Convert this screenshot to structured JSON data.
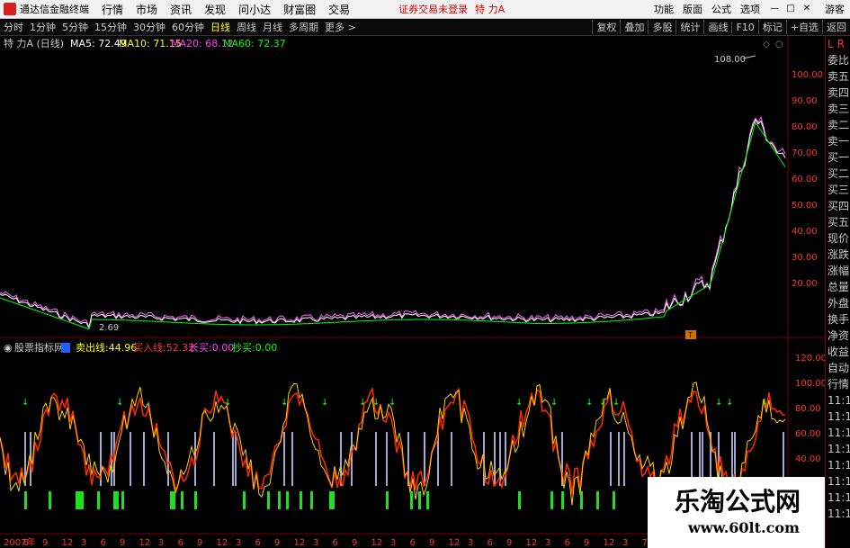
{
  "menubar": {
    "app_name": "通达信金融终端",
    "items": [
      "行情",
      "市场",
      "资讯",
      "发现",
      "问小达",
      "财富圈",
      "交易"
    ],
    "notice": "证券交易未登录",
    "stock_name": "特 力A",
    "right_items": [
      "功能",
      "版面",
      "公式",
      "选项"
    ],
    "guest": "游客"
  },
  "toolbar": {
    "periods": [
      "分时",
      "1分钟",
      "5分钟",
      "15分钟",
      "30分钟",
      "60分钟",
      "日线",
      "周线",
      "月线",
      "多周期",
      "更多 >"
    ],
    "active": "日线",
    "buttons": [
      "复权",
      "叠加",
      "多股",
      "统计",
      "画线",
      "F10",
      "标记",
      "+自选",
      "返回"
    ]
  },
  "main_chart": {
    "stock_label": "特 力A (日线)",
    "ma": [
      {
        "name": "MA5",
        "value": "72.49",
        "color": "#ffffff"
      },
      {
        "name": "MA10",
        "value": "71.15",
        "color": "#ffff00"
      },
      {
        "name": "MA20",
        "value": "68.12",
        "color": "#ff40ff"
      },
      {
        "name": "MA60",
        "value": "72.37",
        "color": "#00ff00"
      }
    ],
    "y_ticks": [
      "100.00",
      "90.00",
      "80.00",
      "70.00",
      "60.00",
      "50.00",
      "40.00",
      "30.00",
      "20.00"
    ],
    "high_label": "108.00",
    "low_label": "2.69",
    "marker_label": "T"
  },
  "indicator": {
    "name": "股票指标网",
    "items": [
      {
        "label": "卖出线:",
        "value": "44.96",
        "color": "#ffff00"
      },
      {
        "label": "买入线:",
        "value": "52.32",
        "color": "#ff3333"
      },
      {
        "label": "长买:",
        "value": "0.00",
        "color": "#ff40ff"
      },
      {
        "label": "抄买:",
        "value": "0.00",
        "color": "#00ff00"
      }
    ],
    "y_ticks": [
      "120.00",
      "100.00",
      "80.00",
      "60.00",
      "40.00"
    ]
  },
  "x_axis": {
    "labels": [
      "2007年",
      "6",
      "9",
      "12",
      "3",
      "6",
      "9",
      "12",
      "3",
      "6",
      "9",
      "12",
      "3",
      "6",
      "9",
      "12",
      "3",
      "6",
      "9",
      "12",
      "3",
      "6",
      "9",
      "12",
      "3",
      "6",
      "9",
      "12",
      "3",
      "6",
      "9",
      "12",
      "3",
      "7"
    ]
  },
  "right_panel": {
    "top": [
      "L",
      "R"
    ],
    "items": [
      "委比",
      "卖五",
      "卖四",
      "卖三",
      "卖二",
      "卖一",
      "买一",
      "买二",
      "买三",
      "买四",
      "买五",
      "现价",
      "涨跌",
      "涨幅",
      "总量",
      "外盘",
      "换手",
      "净资",
      "收益",
      "自动",
      "行情",
      "11:1",
      "11:1",
      "11:1",
      "11:1",
      "11:1",
      "11:1",
      "11:1",
      "11:1"
    ]
  },
  "watermark": {
    "title": "乐淘公式网",
    "url": "www.60lt.com"
  },
  "colors": {
    "up": "#ff3333",
    "down": "#00ffff",
    "axis": "#7a0000"
  }
}
